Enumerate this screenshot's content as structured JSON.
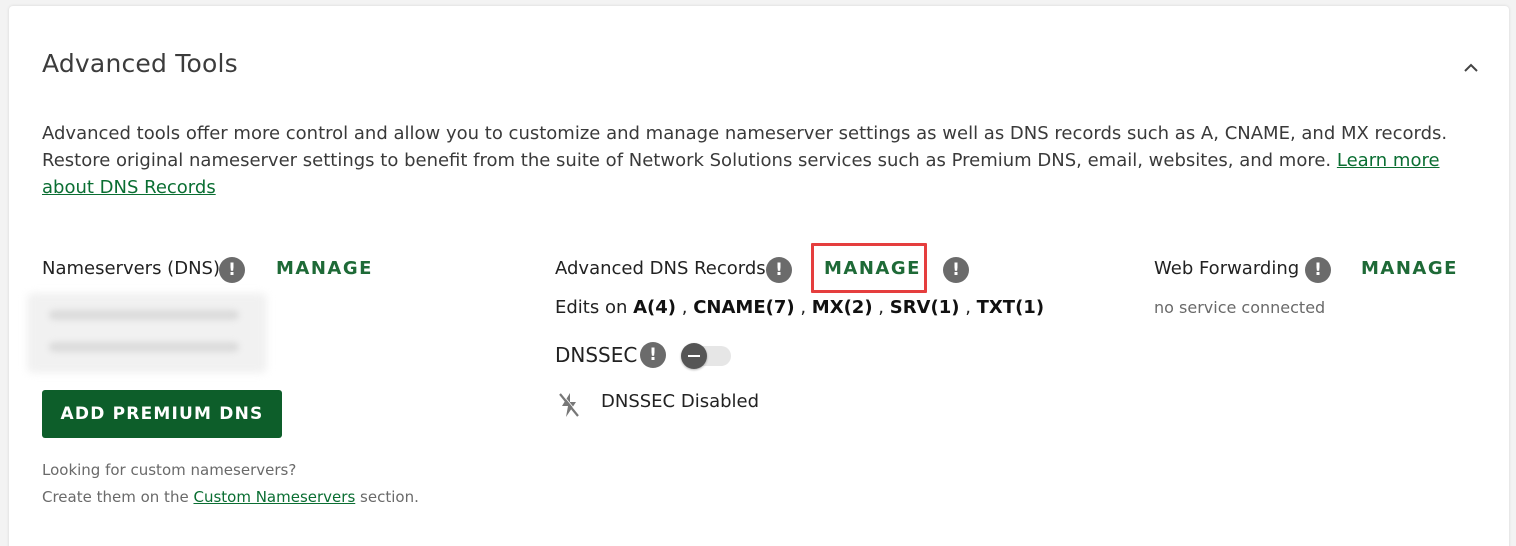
{
  "section": {
    "title": "Advanced Tools",
    "description": "Advanced tools offer more control and allow you to customize and manage nameserver settings as well as DNS records such as A, CNAME, and MX records. Restore original nameserver settings to benefit from the suite of Network Solutions services such as Premium DNS, email, websites, and more.",
    "learn_more_link": "Learn more about DNS Records"
  },
  "nameservers": {
    "label": "Nameservers (DNS)",
    "manage_label": "MANAGE",
    "add_premium_label": "ADD PREMIUM DNS",
    "custom_hint": "Looking for custom nameservers?",
    "custom_prefix": "Create them on the",
    "custom_link": "Custom Nameservers",
    "custom_suffix": "section."
  },
  "dns_records": {
    "label": "Advanced DNS Records",
    "manage_label": "MANAGE",
    "edits_prefix": "Edits on",
    "edits": [
      "A(4)",
      "CNAME(7)",
      "MX(2)",
      "SRV(1)",
      "TXT(1)"
    ],
    "dnssec_label": "DNSSEC",
    "dnssec_status": "DNSSEC Disabled"
  },
  "web_forwarding": {
    "label": "Web Forwarding",
    "manage_label": "MANAGE",
    "status": "no service connected"
  },
  "info_glyph": "!",
  "colors": {
    "accent_green": "#1e6a37",
    "button_green": "#0d5e2a",
    "highlight_red": "#e53e3e",
    "info_gray": "#6b6b6b"
  }
}
